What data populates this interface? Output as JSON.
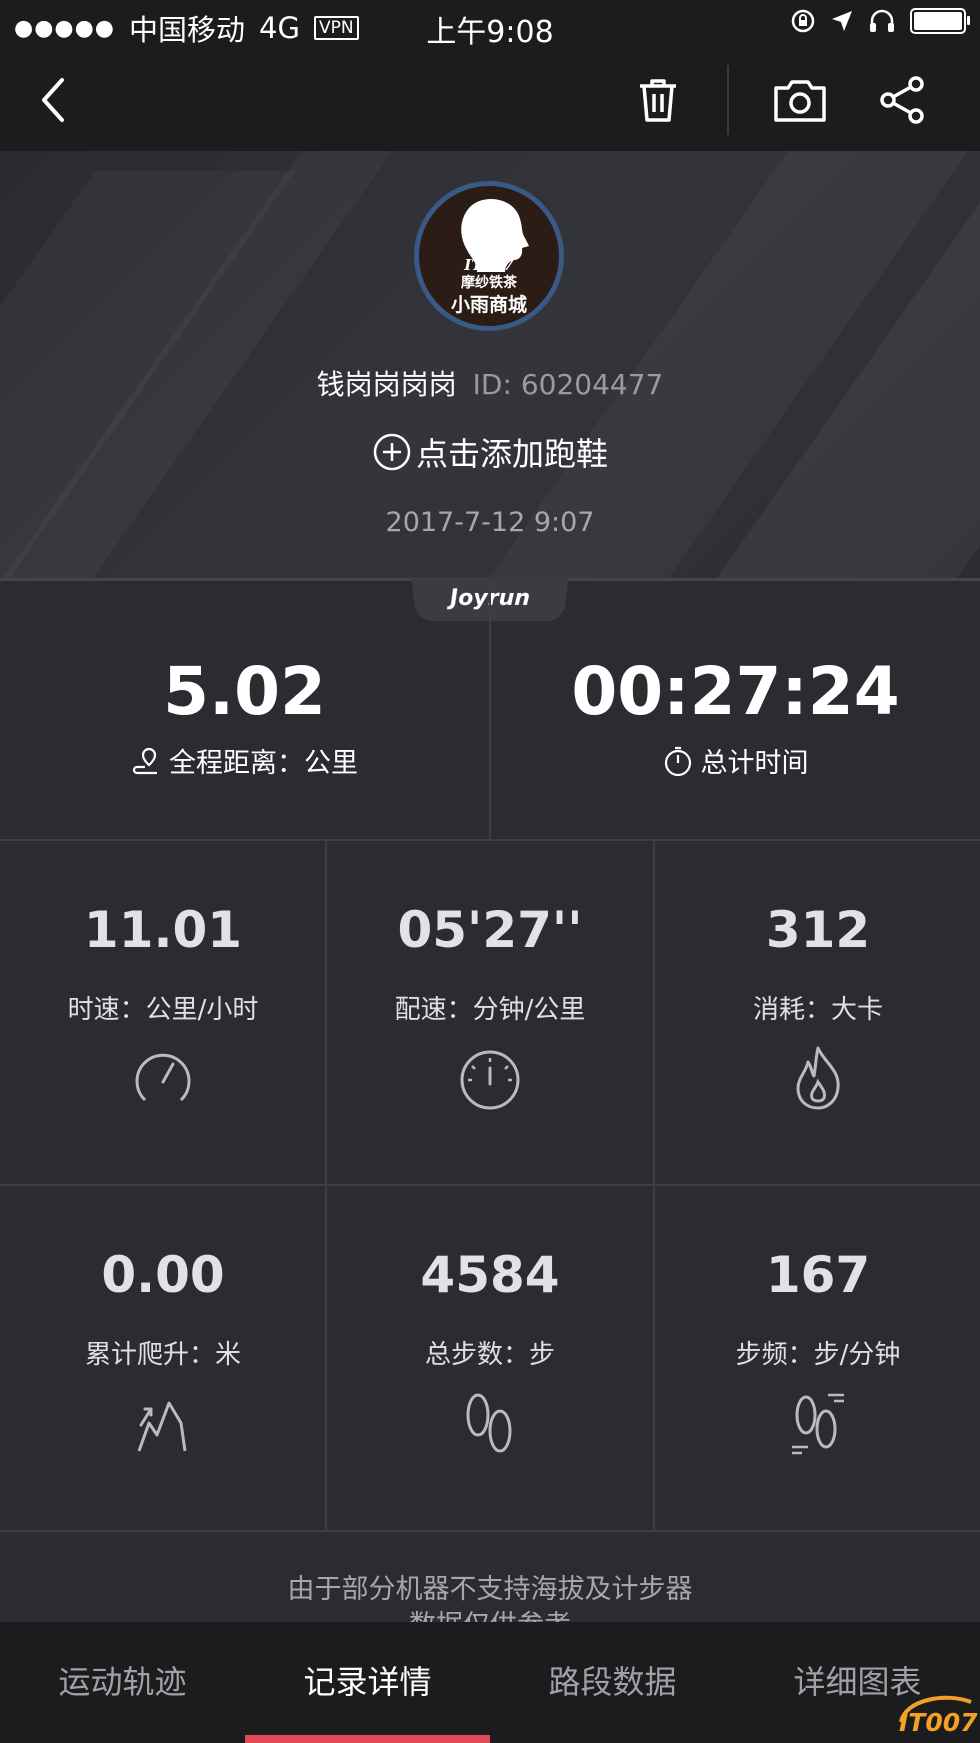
{
  "status_bar": {
    "signal_dots": "●●●●●",
    "carrier": "中国移动",
    "network": "4G",
    "vpn": "VPN",
    "time": "上午9:08"
  },
  "nav": {
    "back_icon": "chevron-left-icon",
    "delete_icon": "trash-icon",
    "camera_icon": "camera-icon",
    "share_icon": "share-icon"
  },
  "profile": {
    "avatar_line1": "IT007",
    "avatar_line2": "摩纱铁茶",
    "avatar_line3": "小雨商城",
    "username": "钱岗岗岗岗",
    "user_id": "ID: 60204477",
    "add_shoe": "点击添加跑鞋",
    "date": "2017-7-12 9:07"
  },
  "brand": "Joyrun",
  "summary": {
    "distance_value": "5.02",
    "distance_label": "全程距离：公里",
    "time_value": "00:27:24",
    "time_label": "总计时间"
  },
  "stats": [
    {
      "value": "11.01",
      "label": "时速：公里/小时",
      "icon": "speedometer-icon"
    },
    {
      "value": "05'27''",
      "label": "配速：分钟/公里",
      "icon": "pace-gauge-icon"
    },
    {
      "value": "312",
      "label": "消耗：大卡",
      "icon": "flame-icon"
    },
    {
      "value": "0.00",
      "label": "累计爬升：米",
      "icon": "climb-icon"
    },
    {
      "value": "4584",
      "label": "总步数：步",
      "icon": "footprints-icon"
    },
    {
      "value": "167",
      "label": "步频：步/分钟",
      "icon": "cadence-icon"
    }
  ],
  "note": "由于部分机器不支持海拔及计步器\n数据仅供参考",
  "tabs": [
    {
      "label": "运动轨迹",
      "active": false
    },
    {
      "label": "记录详情",
      "active": true
    },
    {
      "label": "路段数据",
      "active": false
    },
    {
      "label": "详细图表",
      "active": false
    }
  ],
  "watermark": "IT007",
  "colors": {
    "accent": "#e04a55",
    "background": "#2b2b31",
    "bar": "#1c1c1f"
  }
}
